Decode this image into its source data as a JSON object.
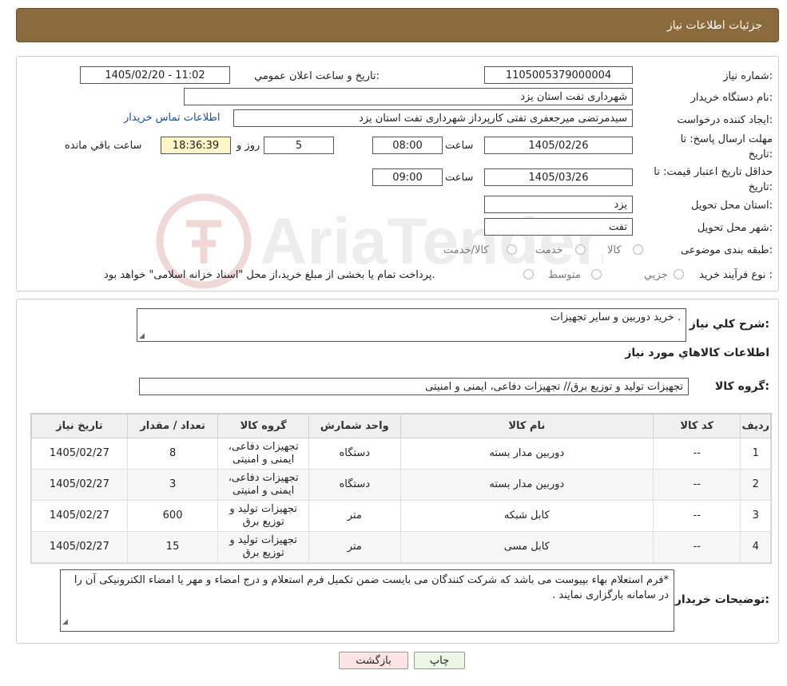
{
  "header": {
    "title": "جزئیات اطلاعات نیاز"
  },
  "form": {
    "need_number_label": "شماره نیاز:",
    "need_number": "1105005379000004",
    "announce_label": "تاريخ و ساعت اعلان عمومي:",
    "announce_value": "1405/02/20 - 11:02",
    "buyer_label": "نام دستگاه خريدار:",
    "buyer_value": "شهرداری تفت استان یزد",
    "creator_label": "ايجاد کننده درخواست:",
    "creator_value": "سیدمرتضی میرجعفری تفتی کارپرداز شهرداری تفت استان یزد",
    "contact_link": "اطلاعات تماس خريدار",
    "deadline_label": "مهلت ارسال پاسخ: تا تاریخ:",
    "deadline_date": "1405/02/26",
    "time_label": "ساعت",
    "deadline_time": "08:00",
    "days_value": "5",
    "days_label": "روز و",
    "remaining_time": "18:36:39",
    "remaining_label": "ساعت باقي مانده",
    "validity_label": "حداقل تاريخ اعتبار قيمت: تا تاریخ:",
    "validity_date": "1405/03/26",
    "validity_time": "09:00",
    "province_label": "استان محل تحويل:",
    "province_value": "یزد",
    "city_label": "شهر محل تحويل:",
    "city_value": "تفت",
    "category_label": "طبقه بندی موضوعی:",
    "category_opt1": "کالا",
    "category_opt2": "خدمت",
    "category_opt3": "کالا/خدمت",
    "process_label": "نوع فرآيند خريد :",
    "process_opt1": "جزيي",
    "process_opt2": "متوسط",
    "process_note": "پرداخت تمام يا بخشی از مبلغ خريد،از محل \"اسناد خزانه اسلامی\" خواهد بود."
  },
  "watermark": {
    "text": "AriaTender.neT"
  },
  "details": {
    "summary_label": "شرح كلي نياز:",
    "summary_value": "خرید دوربین و سایر تجهیزات .",
    "goods_info_title": "اطلاعات كالاهاي مورد نياز",
    "group_label": "گروه كالا:",
    "group_value": "تجهیزات تولید و توزیع برق// تجهیزات دفاعی، ایمنی و امنیتی"
  },
  "table": {
    "headers": [
      "رديف",
      "كد كالا",
      "نام كالا",
      "واحد شمارش",
      "گروه كالا",
      "تعداد / مقدار",
      "تاريخ نياز"
    ],
    "rows": [
      [
        "1",
        "--",
        "دوربین مدار بسته",
        "دستگاه",
        "تجهیزات دفاعی، ایمنی و امنیتی",
        "8",
        "1405/02/27"
      ],
      [
        "2",
        "--",
        "دوربین مدار بسته",
        "دستگاه",
        "تجهیزات دفاعی، ایمنی و امنیتی",
        "3",
        "1405/02/27"
      ],
      [
        "3",
        "--",
        "کابل شبکه",
        "متر",
        "تجهیزات تولید و توزیع برق",
        "600",
        "1405/02/27"
      ],
      [
        "4",
        "--",
        "کابل مسی",
        "متر",
        "تجهیزات تولید و توزیع برق",
        "15",
        "1405/02/27"
      ]
    ]
  },
  "buyer_notes": {
    "label": "توضيحات خريدار:",
    "text": "*فرم استعلام بهاء بپیوست می باشد که شرکت کنندگان می بایست ضمن تکمیل فرم استعلام و درج امضاء و مهر یا امضاء الکترونیکی آن را در سامانه بارگزاری نمایند ."
  },
  "buttons": {
    "print": "چاپ",
    "back": "بازگشت"
  },
  "colors": {
    "header_bg": "#8b6a3d",
    "link": "#1a4fa8",
    "back_button_bg": "#fde3e3",
    "print_button_bg": "#eaf7e4"
  }
}
